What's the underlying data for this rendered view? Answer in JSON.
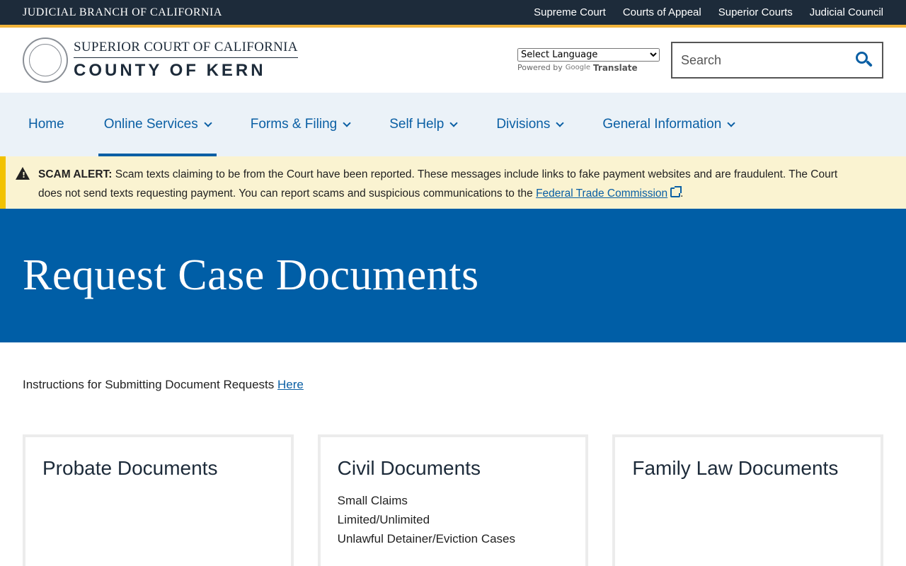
{
  "topbar": {
    "branch": "JUDICIAL BRANCH OF CALIFORNIA",
    "links": [
      "Supreme Court",
      "Courts of Appeal",
      "Superior Courts",
      "Judicial Council"
    ]
  },
  "header": {
    "logo_top": "SUPERIOR COURT OF CALIFORNIA",
    "logo_bottom": "COUNTY OF KERN",
    "language_select": "Select Language",
    "powered_by": "Powered by",
    "google": "Google",
    "translate": "Translate",
    "search_placeholder": "Search"
  },
  "nav": {
    "items": [
      {
        "label": "Home"
      },
      {
        "label": "Online Services"
      },
      {
        "label": "Forms & Filing"
      },
      {
        "label": "Self Help"
      },
      {
        "label": "Divisions"
      },
      {
        "label": "General Information"
      }
    ]
  },
  "alert": {
    "title": "SCAM ALERT:",
    "text": " Scam texts claiming to be from the Court have been reported. These messages include links to fake payment websites and are fraudulent. The Court does not send texts requesting payment. You can report scams and suspicious communications to the ",
    "link": "Federal Trade Commission",
    "end": "."
  },
  "hero": {
    "title": "Request Case Documents"
  },
  "content": {
    "instructions": "Instructions for Submitting Document Requests ",
    "instructions_link": "Here"
  },
  "cards": [
    {
      "title": "Probate Documents",
      "items": []
    },
    {
      "title": "Civil Documents",
      "items": [
        "Small Claims",
        "Limited/Unlimited",
        "Unlawful Detainer/Eviction Cases"
      ]
    },
    {
      "title": "Family Law Documents",
      "items": []
    }
  ],
  "colors": {
    "topbar": "#1d2b3a",
    "accent_gold": "#f2b43a",
    "primary_blue": "#005ea6",
    "link_blue": "#0a5fa4",
    "nav_bg": "#ebf2f8",
    "alert_bg": "#faf3d1"
  }
}
